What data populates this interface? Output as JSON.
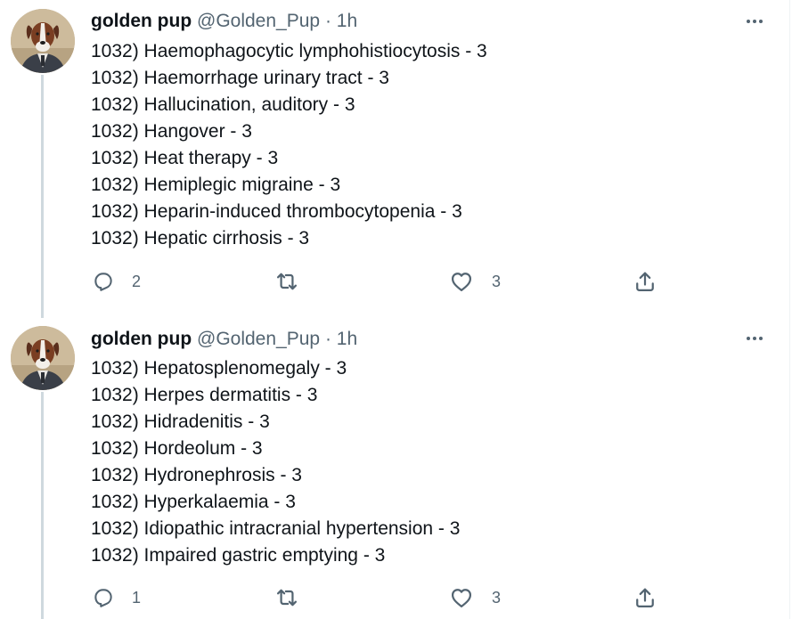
{
  "tweets": [
    {
      "display_name": "golden pup",
      "handle": "@Golden_Pup",
      "separator": "·",
      "time": "1h",
      "avatar_icon": "dog-avatar",
      "lines": [
        "1032) Haemophagocytic lymphohistiocytosis - 3",
        "1032) Haemorrhage urinary tract - 3",
        "1032) Hallucination, auditory - 3",
        "1032) Hangover - 3",
        "1032) Heat therapy - 3",
        "1032) Hemiplegic migraine - 3",
        "1032) Heparin-induced thrombocytopenia - 3",
        "1032) Hepatic cirrhosis - 3"
      ],
      "reply_count": "2",
      "retweet_count": "",
      "like_count": "3"
    },
    {
      "display_name": "golden pup",
      "handle": "@Golden_Pup",
      "separator": "·",
      "time": "1h",
      "avatar_icon": "dog-avatar",
      "lines": [
        "1032) Hepatosplenomegaly - 3",
        "1032) Herpes dermatitis - 3",
        "1032) Hidradenitis - 3",
        "1032) Hordeolum - 3",
        "1032) Hydronephrosis - 3",
        "1032) Hyperkalaemia - 3",
        "1032) Idiopathic intracranial hypertension - 3",
        "1032) Impaired gastric emptying - 3"
      ],
      "reply_count": "1",
      "retweet_count": "",
      "like_count": "3"
    }
  ],
  "colors": {
    "text_primary": "#0f1419",
    "text_secondary": "#536471",
    "thread_line": "#cfd9de"
  }
}
